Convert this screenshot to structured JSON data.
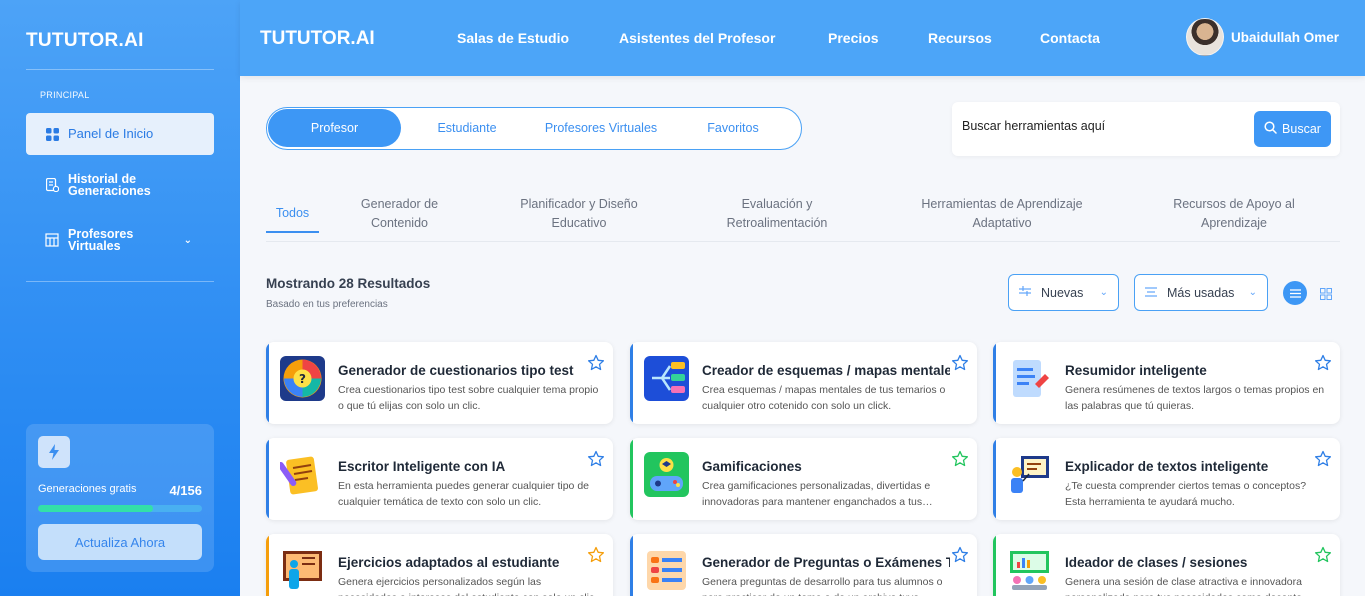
{
  "sidebar": {
    "logo": "TUTUTOR.AI",
    "section_label": "PRINCIPAL",
    "items": [
      {
        "label": "Panel de Inicio"
      },
      {
        "label": "Historial de Generaciones"
      },
      {
        "label": "Profesores Virtuales"
      }
    ],
    "promo": {
      "label": "Generaciones gratis",
      "count": "4/156",
      "progress_fraction": 0.7,
      "button_label": "Actualiza Ahora"
    }
  },
  "header": {
    "logo": "TUTUTOR.AI",
    "nav": [
      "Salas de Estudio",
      "Asistentes del Profesor",
      "Precios",
      "Recursos",
      "Contacta"
    ],
    "user_name": "Ubaidullah Omer"
  },
  "role_tabs": [
    "Profesor",
    "Estudiante",
    "Profesores Virtuales",
    "Favoritos"
  ],
  "search": {
    "placeholder": "Buscar herramientas aquí",
    "button_label": "Buscar"
  },
  "categories": [
    "Todos",
    "Generador de Contenido",
    "Planificador y Diseño Educativo",
    "Evaluación y Retroalimentación",
    "Herramientas de Aprendizaje Adaptativo",
    "Recursos de Apoyo al Aprendizaje"
  ],
  "results": {
    "title": "Mostrando 28 Resultados",
    "subtitle": "Basado en tus preferencias",
    "sort_new": "Nuevas",
    "sort_used": "Más usadas"
  },
  "colors": {
    "primary": "#3d97f5",
    "accent_blue": "#2f7fe6",
    "accent_green": "#22c55e",
    "accent_orange": "#f59e0b",
    "progress": "#33e0a8"
  },
  "cards": [
    {
      "title": "Generador de cuestionarios tipo test",
      "desc": "Crea cuestionarios tipo test sobre cualquier tema propio o que tú elijas con solo un clic.",
      "accent": "blue",
      "icon": "quiz-wheel-icon"
    },
    {
      "title": "Creador de esquemas / mapas mentales",
      "desc": "Crea esquemas / mapas mentales de tus temarios o cualquier otro cotenido con solo un click.",
      "accent": "blue",
      "icon": "mind-map-icon"
    },
    {
      "title": "Resumidor inteligente",
      "desc": "Genera resúmenes de textos largos o temas propios en las palabras que tú quieras.",
      "accent": "blue",
      "icon": "document-summary-icon"
    },
    {
      "title": "Escritor Inteligente con IA",
      "desc": "En esta herramienta puedes generar cualquier tipo de cualquier temática de texto con solo un clic.",
      "accent": "blue",
      "icon": "notepad-pen-icon"
    },
    {
      "title": "Gamificaciones",
      "desc": "Crea gamificaciones personalizadas, divertidas e innovadoras para mantener enganchados a tus alumnos.",
      "accent": "green",
      "icon": "gamepad-icon"
    },
    {
      "title": "Explicador de textos inteligente",
      "desc": "¿Te cuesta comprender ciertos temas o conceptos? Esta herramienta te ayudará mucho.",
      "accent": "blue",
      "icon": "presenter-board-icon"
    },
    {
      "title": "Ejercicios adaptados al estudiante",
      "desc": "Genera ejercicios personalizados según las necesidades e intereses del estudiante con solo un clic.",
      "accent": "orange",
      "icon": "student-board-icon"
    },
    {
      "title": "Generador de Preguntas o Exámenes Tipo Test",
      "desc": "Genera preguntas de desarrollo para tus alumnos o para practicar de un tema o de un archivo tuyo.",
      "accent": "blue",
      "icon": "question-list-icon"
    },
    {
      "title": "Ideador de clases / sesiones",
      "desc": "Genera una sesión de clase atractiva e innovadora personalizada para tus necesidades como docente.",
      "accent": "green",
      "icon": "classroom-icon"
    }
  ]
}
